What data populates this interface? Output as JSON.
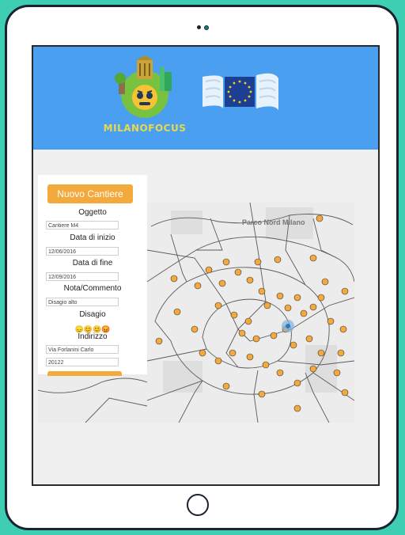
{
  "header": {
    "logo_text": "MILANOFOCUS",
    "brand_color": "#4a9ff0"
  },
  "form": {
    "new_button_label": "Nuovo Cantiere",
    "oggetto_label": "Oggetto",
    "oggetto_value": "Cantiere M4",
    "start_date_label": "Data di inizio",
    "start_date_value": "12/06/2016",
    "end_date_label": "Data di fine",
    "end_date_value": "12/09/2016",
    "note_label": "Nota/Commento",
    "note_value": "Disagio alto",
    "disagio_label": "Disagio",
    "disagio_icons": "😞😊😊😡",
    "indirizzo_label": "Indirizzo",
    "address_value": "Via Forlanini Carlo",
    "zip_value": "20122",
    "accent_color": "#f4a93c"
  },
  "map": {
    "park_label": "Parco Nord Milano",
    "marker_icon": "construction-marker-icon"
  }
}
